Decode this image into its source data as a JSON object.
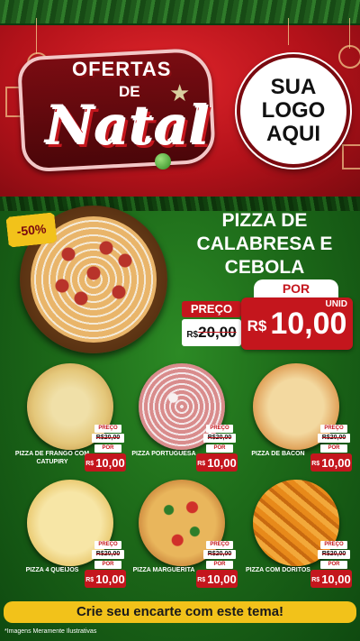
{
  "header": {
    "title_line1": "OFERTAS",
    "title_line2": "DE",
    "title_line3": "Natal",
    "logo_placeholder": [
      "SUA",
      "LOGO",
      "AQUI"
    ]
  },
  "featured": {
    "discount": "-50%",
    "name": "PIZZA DE CALABRESA E CEBOLA",
    "por_label": "POR",
    "preco_label": "PREÇO",
    "old_currency": "R$",
    "old_price": "20,00",
    "new_currency": "R$",
    "new_price": "10,00",
    "unit": "UNID"
  },
  "items": [
    {
      "name": "PIZZA DE FRANGO COM CATUPIRY",
      "preco_label": "PREÇO",
      "old_price": "R$20,00",
      "por_label": "POR",
      "currency": "R$",
      "new_price": "10,00"
    },
    {
      "name": "PIZZA PORTUGUESA",
      "preco_label": "PREÇO",
      "old_price": "R$20,00",
      "por_label": "POR",
      "currency": "R$",
      "new_price": "10,00"
    },
    {
      "name": "PIZZA DE BACON",
      "preco_label": "PREÇO",
      "old_price": "R$20,00",
      "por_label": "POR",
      "currency": "R$",
      "new_price": "10,00"
    },
    {
      "name": "PIZZA 4 QUEIJOS",
      "preco_label": "PREÇO",
      "old_price": "R$20,00",
      "por_label": "POR",
      "currency": "R$",
      "new_price": "10,00"
    },
    {
      "name": "PIZZA MARGUERITA",
      "preco_label": "PREÇO",
      "old_price": "R$20,00",
      "por_label": "POR",
      "currency": "R$",
      "new_price": "10,00"
    },
    {
      "name": "PIZZA COM DORITOS",
      "preco_label": "PREÇO",
      "old_price": "R$20,00",
      "por_label": "POR",
      "currency": "R$",
      "new_price": "10,00"
    }
  ],
  "cta": "Crie seu encarte com este tema!",
  "disclaimer": "*Imagens Meramente Ilustrativas",
  "colors": {
    "red": "#c4161d",
    "green": "#1d6a19",
    "yellow": "#f2c21a"
  }
}
